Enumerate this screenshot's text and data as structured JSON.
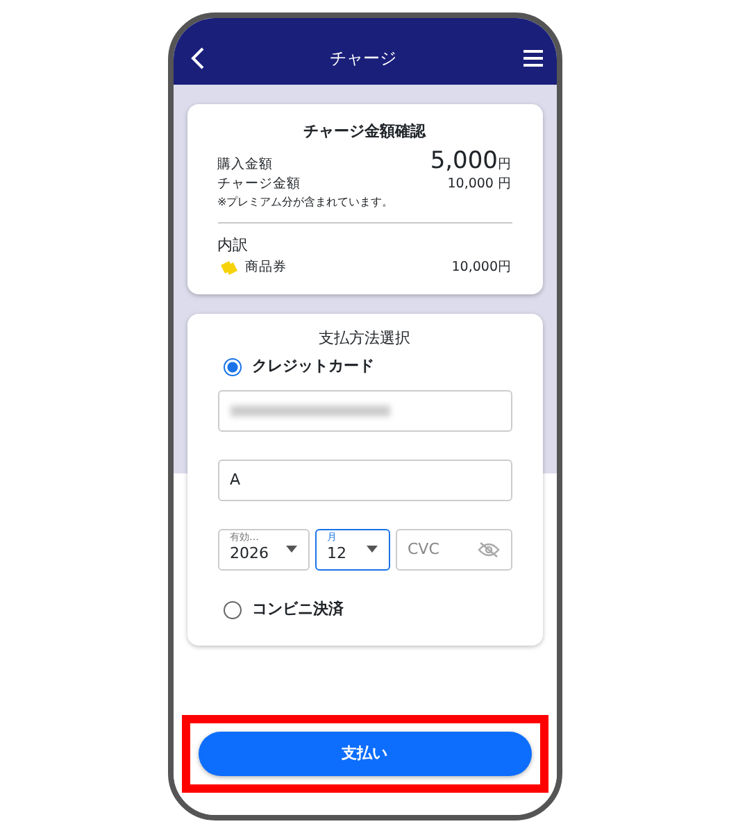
{
  "header": {
    "title": "チャージ"
  },
  "summary": {
    "title": "チャージ金額確認",
    "purchase": {
      "label": "購入金額",
      "amount": "5,000",
      "unit": "円"
    },
    "charge": {
      "label": "チャージ金額",
      "amount": "10,000 円"
    },
    "note": "※プレミアム分が含まれています。",
    "breakdown_title": "内訳",
    "breakdown": [
      {
        "label": "商品券",
        "amount": "10,000円"
      }
    ]
  },
  "payment": {
    "title": "支払方法選択",
    "methods": [
      {
        "label": "クレジットカード",
        "selected": true
      },
      {
        "label": "コンビニ決済",
        "selected": false
      }
    ],
    "card_number": {
      "blurred": true
    },
    "name_field": {
      "value": "A"
    },
    "expiry_year": {
      "label": "有効…",
      "value": "2026",
      "focused": false
    },
    "expiry_month": {
      "label": "月",
      "value": "12",
      "focused": true
    },
    "cvc": {
      "placeholder": "CVC"
    }
  },
  "pay_button": {
    "label": "支払い",
    "highlighted": true
  }
}
